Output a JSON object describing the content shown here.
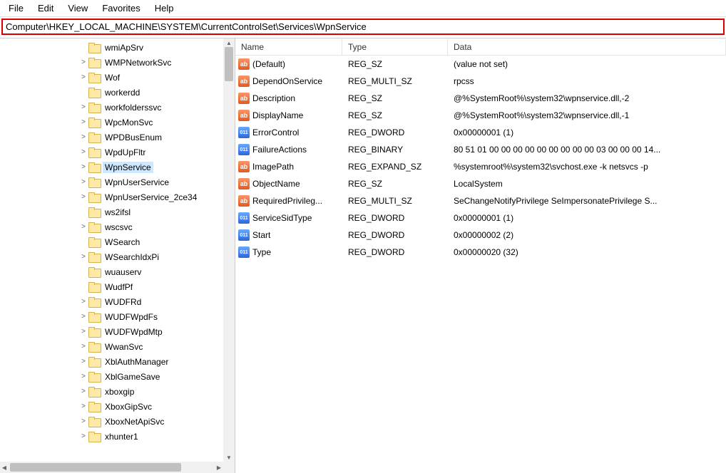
{
  "menu": {
    "file": "File",
    "edit": "Edit",
    "view": "View",
    "favorites": "Favorites",
    "help": "Help"
  },
  "address": "Computer\\HKEY_LOCAL_MACHINE\\SYSTEM\\CurrentControlSet\\Services\\WpnService",
  "tree": {
    "items": [
      {
        "label": "wmiApSrv",
        "expand": ""
      },
      {
        "label": "WMPNetworkSvc",
        "expand": ">"
      },
      {
        "label": "Wof",
        "expand": ">"
      },
      {
        "label": "workerdd",
        "expand": ""
      },
      {
        "label": "workfolderssvc",
        "expand": ">"
      },
      {
        "label": "WpcMonSvc",
        "expand": ">"
      },
      {
        "label": "WPDBusEnum",
        "expand": ">"
      },
      {
        "label": "WpdUpFltr",
        "expand": ">"
      },
      {
        "label": "WpnService",
        "expand": ">",
        "selected": true
      },
      {
        "label": "WpnUserService",
        "expand": ">"
      },
      {
        "label": "WpnUserService_2ce34",
        "expand": ">"
      },
      {
        "label": "ws2ifsl",
        "expand": ""
      },
      {
        "label": "wscsvc",
        "expand": ">"
      },
      {
        "label": "WSearch",
        "expand": ""
      },
      {
        "label": "WSearchIdxPi",
        "expand": ">"
      },
      {
        "label": "wuauserv",
        "expand": ""
      },
      {
        "label": "WudfPf",
        "expand": ""
      },
      {
        "label": "WUDFRd",
        "expand": ">"
      },
      {
        "label": "WUDFWpdFs",
        "expand": ">"
      },
      {
        "label": "WUDFWpdMtp",
        "expand": ">"
      },
      {
        "label": "WwanSvc",
        "expand": ">"
      },
      {
        "label": "XblAuthManager",
        "expand": ">"
      },
      {
        "label": "XblGameSave",
        "expand": ">"
      },
      {
        "label": "xboxgip",
        "expand": ">"
      },
      {
        "label": "XboxGipSvc",
        "expand": ">"
      },
      {
        "label": "XboxNetApiSvc",
        "expand": ">"
      },
      {
        "label": "xhunter1",
        "expand": ">"
      }
    ]
  },
  "values": {
    "headers": {
      "name": "Name",
      "type": "Type",
      "data": "Data"
    },
    "rows": [
      {
        "icon": "sz",
        "name": "(Default)",
        "type": "REG_SZ",
        "data": "(value not set)"
      },
      {
        "icon": "sz",
        "name": "DependOnService",
        "type": "REG_MULTI_SZ",
        "data": "rpcss"
      },
      {
        "icon": "sz",
        "name": "Description",
        "type": "REG_SZ",
        "data": "@%SystemRoot%\\system32\\wpnservice.dll,-2"
      },
      {
        "icon": "sz",
        "name": "DisplayName",
        "type": "REG_SZ",
        "data": "@%SystemRoot%\\system32\\wpnservice.dll,-1"
      },
      {
        "icon": "bin",
        "name": "ErrorControl",
        "type": "REG_DWORD",
        "data": "0x00000001 (1)"
      },
      {
        "icon": "bin",
        "name": "FailureActions",
        "type": "REG_BINARY",
        "data": "80 51 01 00 00 00 00 00 00 00 00 00 03 00 00 00 14..."
      },
      {
        "icon": "sz",
        "name": "ImagePath",
        "type": "REG_EXPAND_SZ",
        "data": "%systemroot%\\system32\\svchost.exe -k netsvcs -p"
      },
      {
        "icon": "sz",
        "name": "ObjectName",
        "type": "REG_SZ",
        "data": "LocalSystem"
      },
      {
        "icon": "sz",
        "name": "RequiredPrivileg...",
        "type": "REG_MULTI_SZ",
        "data": "SeChangeNotifyPrivilege SeImpersonatePrivilege S..."
      },
      {
        "icon": "bin",
        "name": "ServiceSidType",
        "type": "REG_DWORD",
        "data": "0x00000001 (1)"
      },
      {
        "icon": "bin",
        "name": "Start",
        "type": "REG_DWORD",
        "data": "0x00000002 (2)"
      },
      {
        "icon": "bin",
        "name": "Type",
        "type": "REG_DWORD",
        "data": "0x00000020 (32)"
      }
    ]
  },
  "icon_text": {
    "sz": "ab",
    "bin": "011\n110"
  }
}
